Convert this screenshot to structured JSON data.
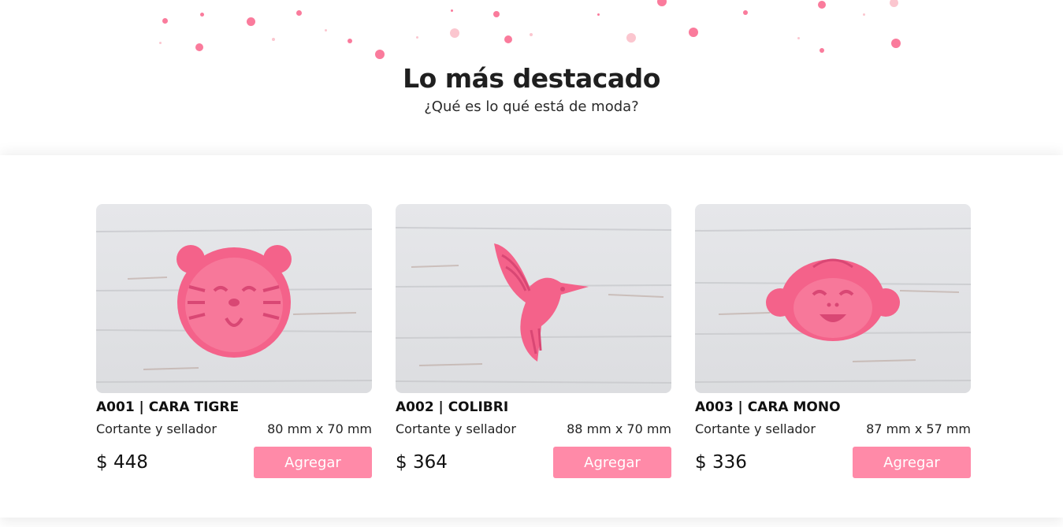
{
  "header": {
    "title": "Lo más destacado",
    "subtitle": "¿Qué es lo qué está de moda?"
  },
  "colors": {
    "accent": "#ff8aa8",
    "dot_primary": "#fa7b9c",
    "dot_light": "#fbc6cf",
    "cookie_cutter": "#f4628a"
  },
  "products": [
    {
      "name": "A001 | CARA TIGRE",
      "description": "Cortante y sellador",
      "size": "80 mm x 70 mm",
      "price": "$ 448",
      "button_label": "Agregar",
      "image_subject": "tiger-face-cookie-cutter"
    },
    {
      "name": "A002 | COLIBRI",
      "description": "Cortante y sellador",
      "size": "88 mm x 70 mm",
      "price": "$ 364",
      "button_label": "Agregar",
      "image_subject": "hummingbird-cookie-cutter"
    },
    {
      "name": "A003 | CARA MONO",
      "description": "Cortante y sellador",
      "size": "87 mm x 57 mm",
      "price": "$ 336",
      "button_label": "Agregar",
      "image_subject": "monkey-face-cookie-cutter"
    }
  ]
}
